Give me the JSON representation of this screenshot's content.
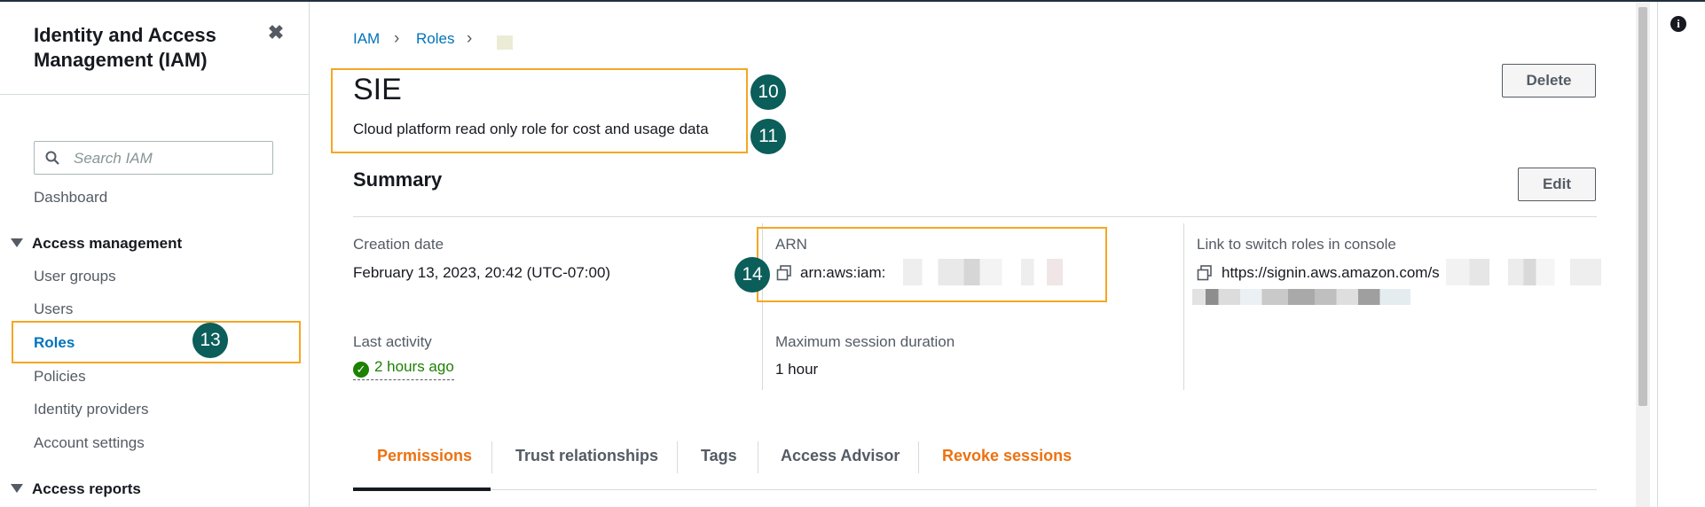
{
  "sidebar": {
    "title": "Identity and Access Management (IAM)",
    "close_glyph": "✖",
    "search_placeholder": "Search IAM",
    "items": {
      "dashboard": "Dashboard",
      "access_management": "Access management",
      "user_groups": "User groups",
      "users": "Users",
      "roles": "Roles",
      "policies": "Policies",
      "identity_providers": "Identity providers",
      "account_settings": "Account settings",
      "access_reports": "Access reports"
    }
  },
  "breadcrumb": {
    "iam": "IAM",
    "roles": "Roles",
    "sep": "›"
  },
  "role": {
    "name": "SIE",
    "description": "Cloud platform read only role for cost and usage data"
  },
  "buttons": {
    "delete": "Delete",
    "edit": "Edit"
  },
  "summary": {
    "title": "Summary",
    "creation_date_label": "Creation date",
    "creation_date_value": "February 13, 2023, 20:42 (UTC-07:00)",
    "arn_label": "ARN",
    "arn_value": "arn:aws:iam:",
    "link_label": "Link to switch roles in console",
    "link_value": "https://signin.aws.amazon.com/s",
    "last_activity_label": "Last activity",
    "last_activity_value": "2 hours ago",
    "max_session_label": "Maximum session duration",
    "max_session_value": "1 hour"
  },
  "tabs": {
    "permissions": "Permissions",
    "trust_relationships": "Trust relationships",
    "tags": "Tags",
    "access_advisor": "Access Advisor",
    "revoke_sessions": "Revoke sessions"
  },
  "annotations": {
    "b10": "10",
    "b11": "11",
    "b13": "13",
    "b14": "14"
  },
  "icons": [
    "close-icon",
    "search-icon",
    "caret-down-icon",
    "copy-icon",
    "check-circle-icon",
    "info-icon"
  ],
  "colors": {
    "link": "#0073bb",
    "active_tab": "#ec7211",
    "success": "#1d8102",
    "highlight": "#f5a623",
    "badge": "#0b5e5a"
  }
}
